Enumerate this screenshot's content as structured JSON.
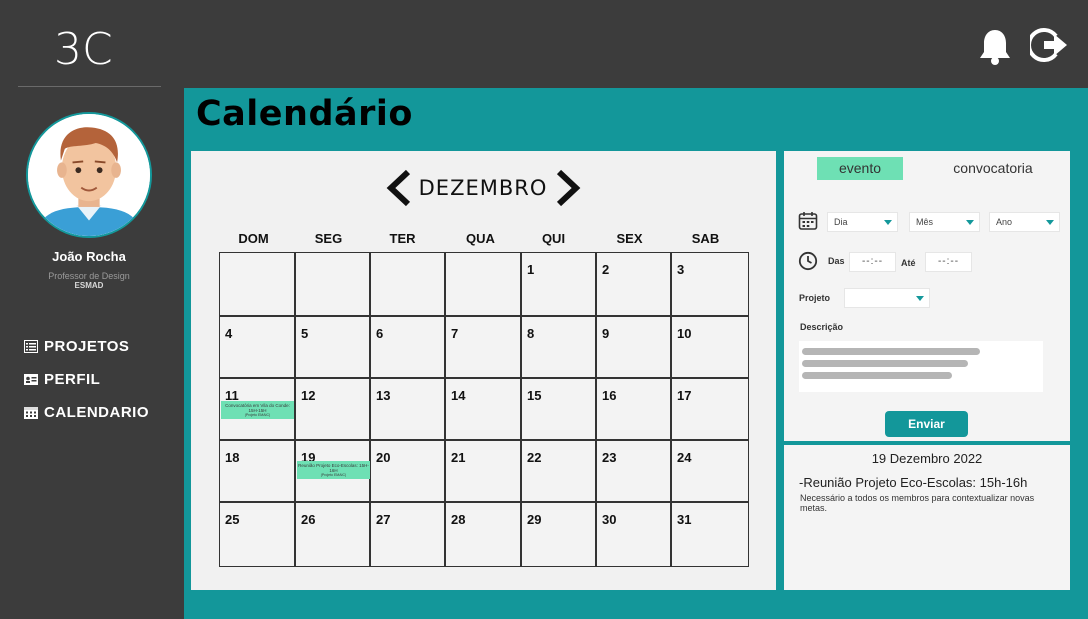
{
  "app": {
    "logo_text": "3C"
  },
  "header": {
    "bell_icon": "bell-icon",
    "logout_icon": "logout-icon"
  },
  "user": {
    "name": "João Rocha",
    "role": "Professor de Design",
    "org": "ESMAD"
  },
  "nav": [
    {
      "label": "PROJETOS",
      "icon": "list-icon"
    },
    {
      "label": "PERFIL",
      "icon": "id-card-icon"
    },
    {
      "label": "CALENDARIO",
      "icon": "calendar-icon"
    }
  ],
  "page": {
    "title": "Calendário"
  },
  "calendar": {
    "month": "DEZEMBRO",
    "weekdays": [
      "DOM",
      "SEG",
      "TER",
      "QUA",
      "QUI",
      "SEX",
      "SAB"
    ],
    "days": [
      "1",
      "2",
      "3",
      "4",
      "5",
      "6",
      "7",
      "8",
      "9",
      "10",
      "11",
      "12",
      "13",
      "14",
      "15",
      "16",
      "17",
      "18",
      "19",
      "20",
      "21",
      "22",
      "23",
      "24",
      "25",
      "26",
      "27",
      "28",
      "29",
      "30",
      "31"
    ],
    "events": [
      {
        "day": "11",
        "text": "Convocatória em Vila do Conde: 15H-15H",
        "sub": "(Projeto EMAIC)"
      },
      {
        "day": "19",
        "text": "Reunião Projeto Eco-Escolas: 15H-16H",
        "sub": "(Projeto EMAIC)"
      }
    ]
  },
  "form": {
    "tab_evento": "evento",
    "tab_convocatoria": "convocatoria",
    "dia": "Dia",
    "mes": "Mês",
    "ano": "Ano",
    "das_label": "Das",
    "ate_label": "Até",
    "time_from": "--:--",
    "time_to": "--:--",
    "projeto_label": "Projeto",
    "projeto_value": "",
    "descricao_label": "Descrição",
    "submit": "Enviar"
  },
  "info": {
    "date": "19 Dezembro 2022",
    "title": "-Reunião Projeto Eco-Escolas: 15h-16h",
    "body": "Necessário a todos os membros para contextualizar novas metas."
  },
  "colors": {
    "teal": "#13979a",
    "mint": "#6ee0b4",
    "dark": "#3c3c3c"
  }
}
